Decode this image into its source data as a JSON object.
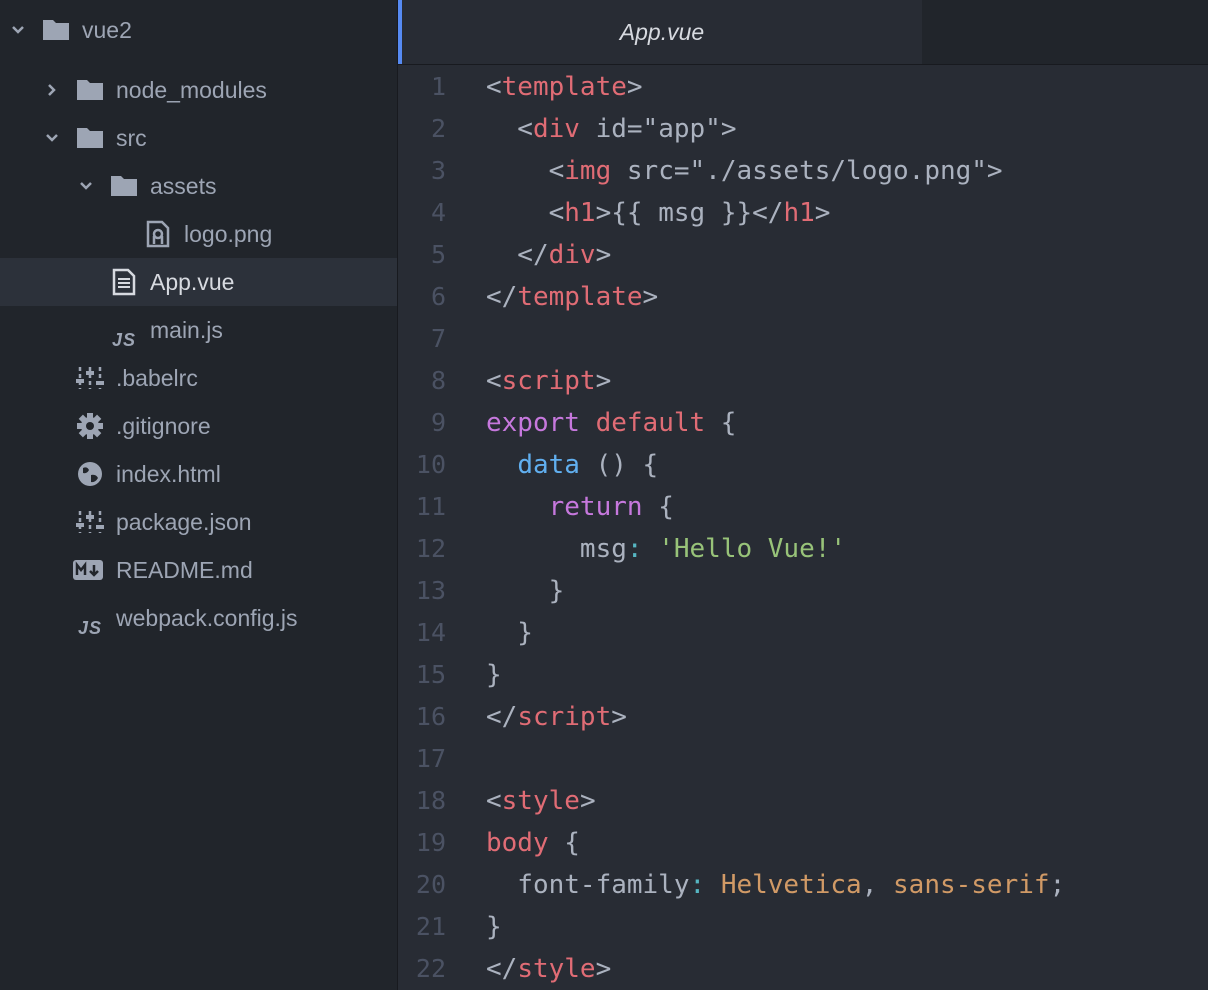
{
  "sidebar": {
    "items": [
      {
        "label": "vue2",
        "icon": "folder-icon",
        "expanded": true
      },
      {
        "label": "node_modules",
        "icon": "folder-icon",
        "expanded": false
      },
      {
        "label": "src",
        "icon": "folder-icon",
        "expanded": true
      },
      {
        "label": "assets",
        "icon": "folder-icon",
        "expanded": true
      },
      {
        "label": "logo.png",
        "icon": "image-file-icon"
      },
      {
        "label": "App.vue",
        "icon": "text-file-icon",
        "selected": true
      },
      {
        "label": "main.js",
        "icon": "js-file-icon",
        "glyph": "JS"
      },
      {
        "label": ".babelrc",
        "icon": "config-file-icon"
      },
      {
        "label": ".gitignore",
        "icon": "gear-icon"
      },
      {
        "label": "index.html",
        "icon": "globe-icon"
      },
      {
        "label": "package.json",
        "icon": "config-file-icon"
      },
      {
        "label": "README.md",
        "icon": "markdown-file-icon"
      },
      {
        "label": "webpack.config.js",
        "icon": "js-file-icon",
        "glyph": "JS"
      }
    ]
  },
  "tabs": [
    {
      "label": "App.vue",
      "active": true
    }
  ],
  "colors": {
    "accent": "#568af2",
    "tag": "#e06c75",
    "keyword": "#c678dd",
    "function": "#61afef",
    "string": "#98c379",
    "value": "#d19a66",
    "operator": "#56b6c2",
    "text": "#abb2bf"
  },
  "editor": {
    "lines": [
      {
        "n": "1",
        "tokens": [
          [
            "def",
            "<"
          ],
          [
            "red",
            "template"
          ],
          [
            "def",
            ">"
          ]
        ]
      },
      {
        "n": "2",
        "tokens": [
          [
            "def",
            "  <"
          ],
          [
            "red",
            "div"
          ],
          [
            "def",
            " id=\"app\">"
          ]
        ]
      },
      {
        "n": "3",
        "tokens": [
          [
            "def",
            "    <"
          ],
          [
            "red",
            "img"
          ],
          [
            "def",
            " src=\"./assets/logo.png\">"
          ]
        ]
      },
      {
        "n": "4",
        "tokens": [
          [
            "def",
            "    <"
          ],
          [
            "red",
            "h1"
          ],
          [
            "def",
            ">{{ msg }}</"
          ],
          [
            "red",
            "h1"
          ],
          [
            "def",
            ">"
          ]
        ]
      },
      {
        "n": "5",
        "tokens": [
          [
            "def",
            "  </"
          ],
          [
            "red",
            "div"
          ],
          [
            "def",
            ">"
          ]
        ]
      },
      {
        "n": "6",
        "tokens": [
          [
            "def",
            "</"
          ],
          [
            "red",
            "template"
          ],
          [
            "def",
            ">"
          ]
        ]
      },
      {
        "n": "7",
        "tokens": []
      },
      {
        "n": "8",
        "tokens": [
          [
            "def",
            "<"
          ],
          [
            "red",
            "script"
          ],
          [
            "def",
            ">"
          ]
        ]
      },
      {
        "n": "9",
        "tokens": [
          [
            "pur",
            "export"
          ],
          [
            "def",
            " "
          ],
          [
            "red",
            "default"
          ],
          [
            "def",
            " {"
          ]
        ]
      },
      {
        "n": "10",
        "tokens": [
          [
            "def",
            "  "
          ],
          [
            "blu",
            "data"
          ],
          [
            "def",
            " () {"
          ]
        ]
      },
      {
        "n": "11",
        "tokens": [
          [
            "def",
            "    "
          ],
          [
            "pur",
            "return"
          ],
          [
            "def",
            " {"
          ]
        ]
      },
      {
        "n": "12",
        "tokens": [
          [
            "def",
            "      msg"
          ],
          [
            "cyn",
            ":"
          ],
          [
            "def",
            " "
          ],
          [
            "grn",
            "'Hello Vue!'"
          ]
        ]
      },
      {
        "n": "13",
        "tokens": [
          [
            "def",
            "    }"
          ]
        ]
      },
      {
        "n": "14",
        "tokens": [
          [
            "def",
            "  }"
          ]
        ]
      },
      {
        "n": "15",
        "tokens": [
          [
            "def",
            "}"
          ]
        ]
      },
      {
        "n": "16",
        "tokens": [
          [
            "def",
            "</"
          ],
          [
            "red",
            "script"
          ],
          [
            "def",
            ">"
          ]
        ]
      },
      {
        "n": "17",
        "tokens": []
      },
      {
        "n": "18",
        "tokens": [
          [
            "def",
            "<"
          ],
          [
            "red",
            "style"
          ],
          [
            "def",
            ">"
          ]
        ]
      },
      {
        "n": "19",
        "tokens": [
          [
            "red",
            "body"
          ],
          [
            "def",
            " {"
          ]
        ]
      },
      {
        "n": "20",
        "tokens": [
          [
            "def",
            "  font-family"
          ],
          [
            "cyn",
            ":"
          ],
          [
            "def",
            " "
          ],
          [
            "org",
            "Helvetica"
          ],
          [
            "def",
            ", "
          ],
          [
            "org",
            "sans-serif"
          ],
          [
            "def",
            ";"
          ]
        ]
      },
      {
        "n": "21",
        "tokens": [
          [
            "def",
            "}"
          ]
        ]
      },
      {
        "n": "22",
        "tokens": [
          [
            "def",
            "</"
          ],
          [
            "red",
            "style"
          ],
          [
            "def",
            ">"
          ]
        ]
      }
    ]
  }
}
